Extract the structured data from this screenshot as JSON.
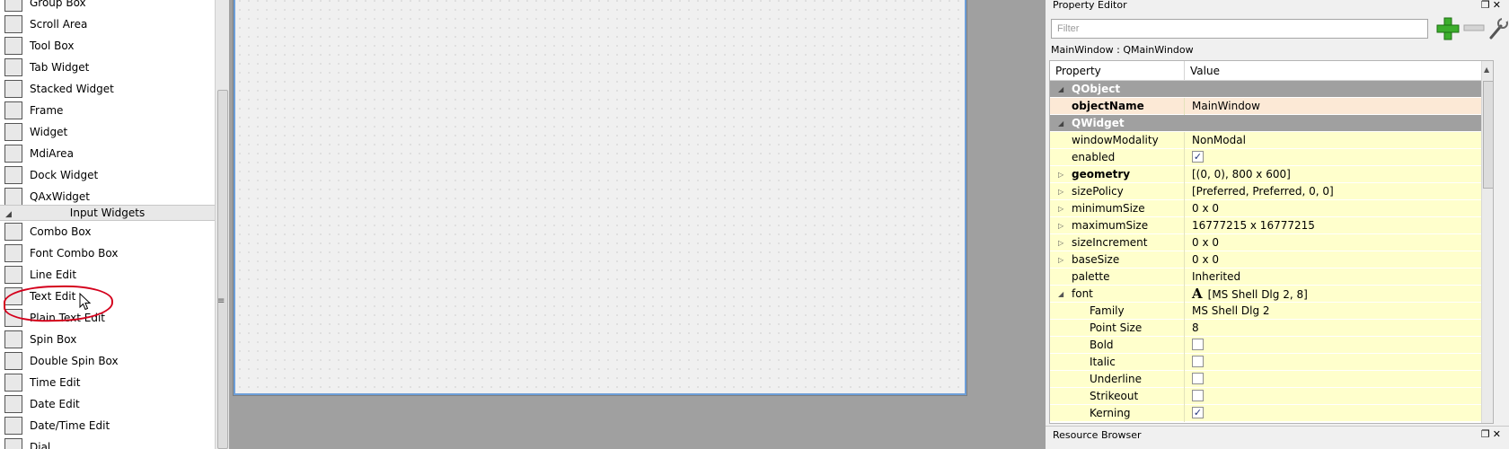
{
  "widget_box": {
    "items": [
      {
        "label": "Group Box",
        "icon": "group-box-icon"
      },
      {
        "label": "Scroll Area",
        "icon": "scroll-area-icon"
      },
      {
        "label": "Tool Box",
        "icon": "tool-box-icon"
      },
      {
        "label": "Tab Widget",
        "icon": "tab-widget-icon"
      },
      {
        "label": "Stacked Widget",
        "icon": "stacked-widget-icon"
      },
      {
        "label": "Frame",
        "icon": "frame-icon"
      },
      {
        "label": "Widget",
        "icon": "widget-icon"
      },
      {
        "label": "MdiArea",
        "icon": "mdi-area-icon"
      },
      {
        "label": "Dock Widget",
        "icon": "dock-widget-icon"
      },
      {
        "label": "QAxWidget",
        "icon": "qax-widget-icon"
      }
    ],
    "category": "Input Widgets",
    "input_items": [
      {
        "label": "Combo Box",
        "icon": "combo-box-icon"
      },
      {
        "label": "Font Combo Box",
        "icon": "font-combo-box-icon"
      },
      {
        "label": "Line Edit",
        "icon": "line-edit-icon"
      },
      {
        "label": "Text Edit",
        "icon": "text-edit-icon"
      },
      {
        "label": "Plain Text Edit",
        "icon": "plain-text-edit-icon"
      },
      {
        "label": "Spin Box",
        "icon": "spin-box-icon"
      },
      {
        "label": "Double Spin Box",
        "icon": "double-spin-box-icon"
      },
      {
        "label": "Time Edit",
        "icon": "time-edit-icon"
      },
      {
        "label": "Date Edit",
        "icon": "date-edit-icon"
      },
      {
        "label": "Date/Time Edit",
        "icon": "date-time-edit-icon"
      },
      {
        "label": "Dial",
        "icon": "dial-icon"
      }
    ],
    "highlight_color": "#d4001c"
  },
  "property_editor": {
    "title": "Property Editor",
    "filter_placeholder": "Filter",
    "class_label": "MainWindow : QMainWindow",
    "columns": [
      "Property",
      "Value"
    ],
    "rows": [
      {
        "kind": "group",
        "name": "QObject"
      },
      {
        "kind": "selected",
        "name": "objectName",
        "value": "MainWindow",
        "bold": true
      },
      {
        "kind": "group",
        "name": "QWidget"
      },
      {
        "kind": "prop",
        "name": "windowModality",
        "value": "NonModal"
      },
      {
        "kind": "prop",
        "name": "enabled",
        "checkbox": true,
        "checked": true
      },
      {
        "kind": "prop",
        "name": "geometry",
        "value": "[(0, 0), 800 x 600]",
        "bold": true,
        "expandable": true
      },
      {
        "kind": "prop",
        "name": "sizePolicy",
        "value": "[Preferred, Preferred, 0, 0]",
        "expandable": true
      },
      {
        "kind": "prop",
        "name": "minimumSize",
        "value": "0 x 0",
        "expandable": true
      },
      {
        "kind": "prop",
        "name": "maximumSize",
        "value": "16777215 x 16777215",
        "expandable": true
      },
      {
        "kind": "prop",
        "name": "sizeIncrement",
        "value": "0 x 0",
        "expandable": true
      },
      {
        "kind": "prop",
        "name": "baseSize",
        "value": "0 x 0",
        "expandable": true
      },
      {
        "kind": "prop",
        "name": "palette",
        "value": "Inherited"
      },
      {
        "kind": "prop",
        "name": "font",
        "value": "[MS Shell Dlg 2, 8]",
        "expanded": true,
        "font_glyph": "A"
      },
      {
        "kind": "sub",
        "name": "Family",
        "value": "MS Shell Dlg 2"
      },
      {
        "kind": "sub",
        "name": "Point Size",
        "value": "8"
      },
      {
        "kind": "sub",
        "name": "Bold",
        "checkbox": true,
        "checked": false
      },
      {
        "kind": "sub",
        "name": "Italic",
        "checkbox": true,
        "checked": false
      },
      {
        "kind": "sub",
        "name": "Underline",
        "checkbox": true,
        "checked": false
      },
      {
        "kind": "sub",
        "name": "Strikeout",
        "checkbox": true,
        "checked": false
      },
      {
        "kind": "sub",
        "name": "Kerning",
        "checkbox": true,
        "checked": true
      }
    ]
  },
  "resource_browser": {
    "title": "Resource Browser"
  },
  "colors": {
    "group_row": "#a0a0a0",
    "prop_row": "#ffffcc",
    "selected_row": "#fce9d6",
    "form_border": "#6d9ed8"
  }
}
